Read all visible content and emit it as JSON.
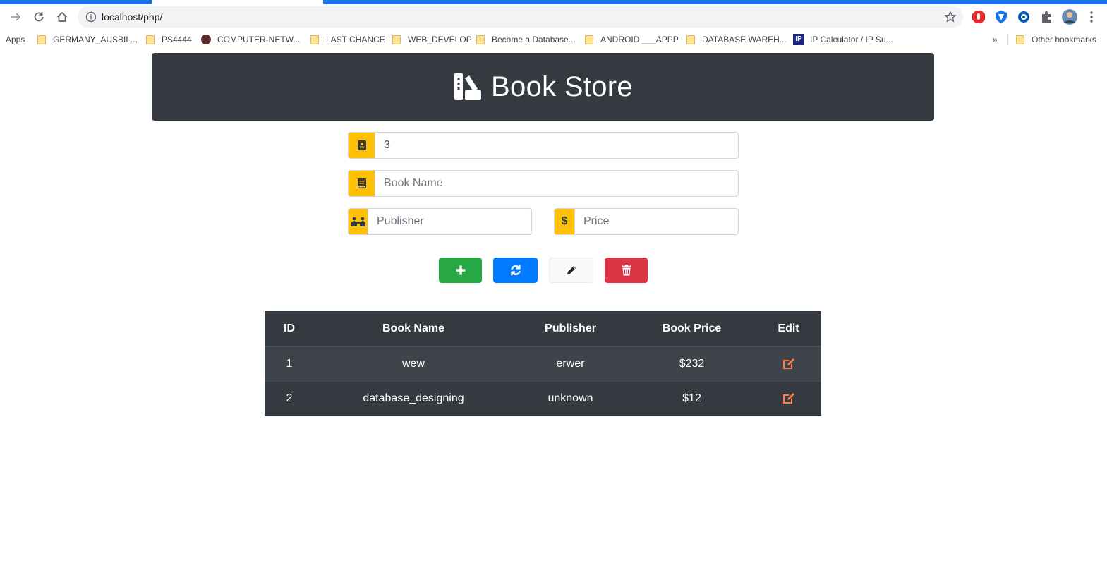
{
  "browser": {
    "url": "localhost/php/",
    "bookmarks": [
      {
        "label": "Apps"
      },
      {
        "label": "GERMANY_AUSBIL..."
      },
      {
        "label": "PS4444"
      },
      {
        "label": "COMPUTER-NETW..."
      },
      {
        "label": "LAST CHANCE"
      },
      {
        "label": "WEB_DEVELOP"
      },
      {
        "label": "Become a Database..."
      },
      {
        "label": "ANDROID ___APPP"
      },
      {
        "label": "DATABASE WAREH..."
      },
      {
        "label": "IP Calculator / IP Su..."
      }
    ],
    "more_label": "»",
    "other_bookmarks": "Other bookmarks"
  },
  "header": {
    "title": "Book Store"
  },
  "form": {
    "id_value": "3",
    "book_name_placeholder": "Book Name",
    "publisher_placeholder": "Publisher",
    "price_placeholder": "Price",
    "price_symbol": "$"
  },
  "table": {
    "headers": [
      "ID",
      "Book Name",
      "Publisher",
      "Book Price",
      "Edit"
    ],
    "rows": [
      {
        "id": "1",
        "name": "wew",
        "publisher": "erwer",
        "price": "$232"
      },
      {
        "id": "2",
        "name": "database_designing",
        "publisher": "unknown",
        "price": "$12"
      }
    ]
  },
  "colors": {
    "header_bg": "#343a40",
    "addon": "#ffc107",
    "add": "#28a745",
    "refresh": "#007bff",
    "delete": "#dc3545",
    "edit_icon": "#fd7e49"
  }
}
